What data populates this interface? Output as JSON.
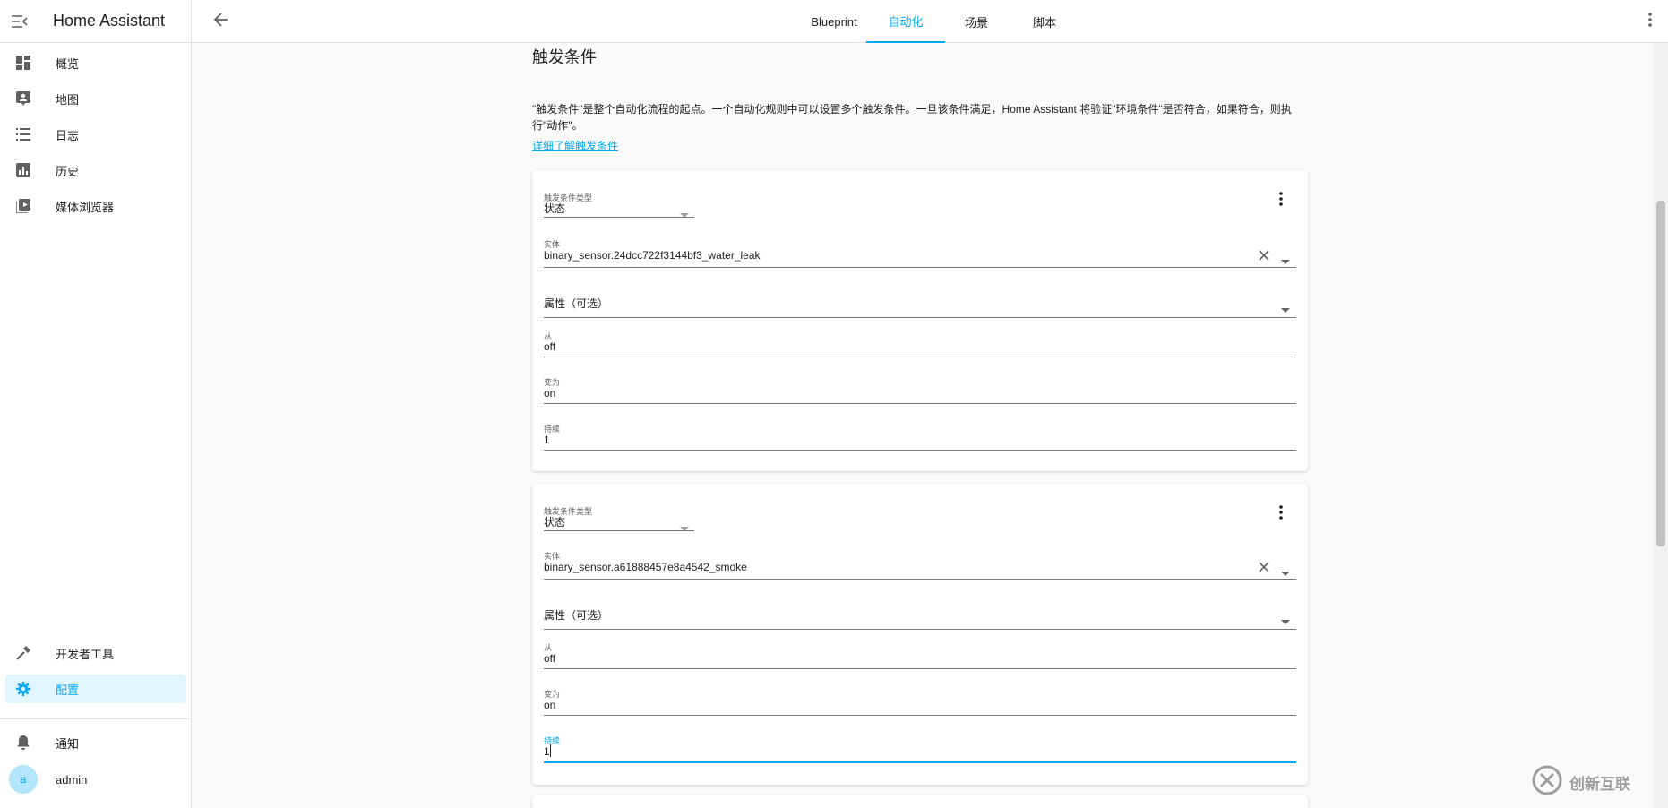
{
  "app": {
    "title": "Home Assistant"
  },
  "sidebar": {
    "items": [
      {
        "label": "概览",
        "icon": "dashboard-icon"
      },
      {
        "label": "地图",
        "icon": "map-icon"
      },
      {
        "label": "日志",
        "icon": "logbook-icon"
      },
      {
        "label": "历史",
        "icon": "history-chart-icon"
      },
      {
        "label": "媒体浏览器",
        "icon": "media-browser-icon"
      }
    ],
    "bottom_items": [
      {
        "label": "开发者工具",
        "icon": "hammer-icon"
      },
      {
        "label": "配置",
        "icon": "gear-icon",
        "active": true
      }
    ],
    "notifications_label": "通知",
    "user": {
      "initial": "a",
      "name": "admin"
    }
  },
  "topbar": {
    "tabs": [
      {
        "label": "Blueprint"
      },
      {
        "label": "自动化",
        "active": true
      },
      {
        "label": "场景"
      },
      {
        "label": "脚本"
      }
    ]
  },
  "section": {
    "title": "触发条件",
    "description": "\"触发条件\"是整个自动化流程的起点。一个自动化规则中可以设置多个触发条件。一旦该条件满足，Home Assistant 将验证\"环境条件\"是否符合，如果符合，则执行\"动作\"。",
    "learn_more": "详细了解触发条件"
  },
  "triggers": [
    {
      "type_label": "触发条件类型",
      "type_value": "状态",
      "entity_label": "实体",
      "entity_value": "binary_sensor.24dcc722f3144bf3_water_leak",
      "attribute_placeholder": "属性（可选）",
      "from_label": "从",
      "from_value": "off",
      "to_label": "变为",
      "to_value": "on",
      "for_label": "持续",
      "for_value": "1"
    },
    {
      "type_label": "触发条件类型",
      "type_value": "状态",
      "entity_label": "实体",
      "entity_value": "binary_sensor.a61888457e8a4542_smoke",
      "attribute_placeholder": "属性（可选）",
      "from_label": "从",
      "from_value": "off",
      "to_label": "变为",
      "to_value": "on",
      "for_label": "持续",
      "for_value": "1"
    }
  ],
  "watermark": {
    "text": "创新互联"
  },
  "colors": {
    "accent": "#03a9f4",
    "active_bg": "#e1f5fe",
    "text": "#212121"
  }
}
